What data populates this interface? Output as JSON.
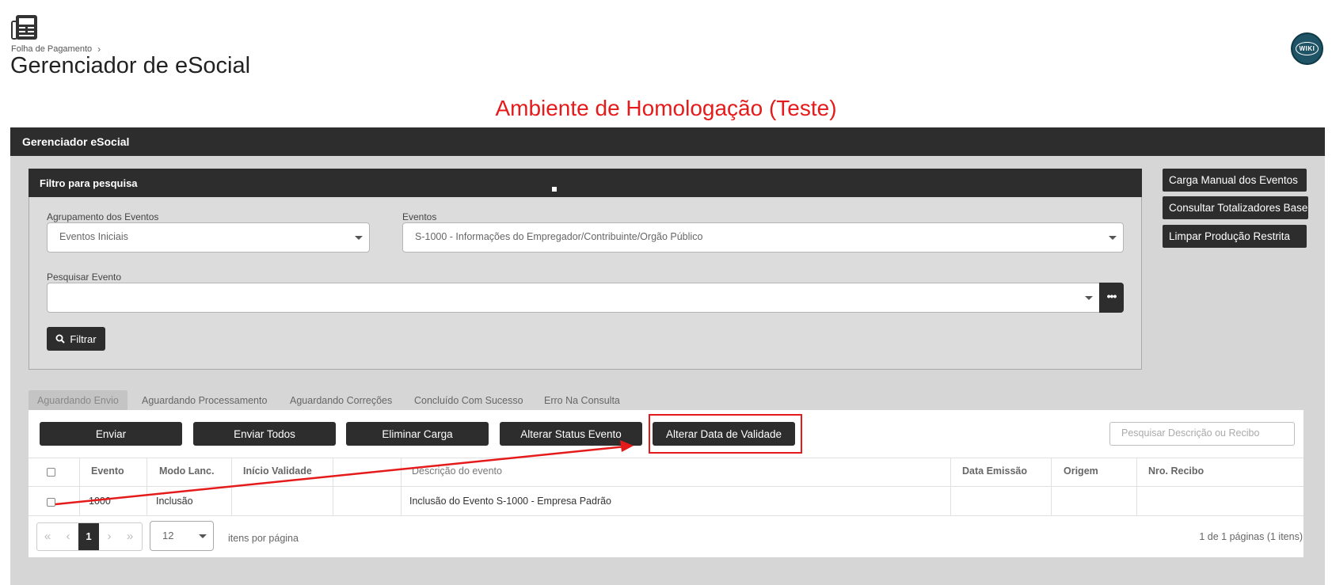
{
  "header": {
    "breadcrumb": "Folha de Pagamento",
    "title": "Gerenciador de eSocial",
    "wiki_label": "WIKI",
    "environment_banner": "Ambiente de Homologação (Teste)"
  },
  "main_panel": {
    "title": "Gerenciador eSocial"
  },
  "filter": {
    "title": "Filtro para pesquisa",
    "group_label": "Agrupamento dos Eventos",
    "group_value": "Eventos Iniciais",
    "events_label": "Eventos",
    "events_value": "S-1000 - Informações do Empregador/Contribuinte/Orgão Público",
    "search_label": "Pesquisar Evento",
    "search_value": "",
    "more_label": "•••",
    "filter_button": "Filtrar"
  },
  "side_buttons": {
    "manual_load": "Carga Manual dos Eventos",
    "totalizers": "Consultar Totalizadores Base",
    "clear_restricted": "Limpar Produção Restrita"
  },
  "tabs": [
    {
      "label": "Aguardando Envio"
    },
    {
      "label": "Aguardando Processamento"
    },
    {
      "label": "Aguardando Correções"
    },
    {
      "label": "Concluído Com Sucesso"
    },
    {
      "label": "Erro Na Consulta"
    }
  ],
  "actions": {
    "send": "Enviar",
    "send_all": "Enviar Todos",
    "delete_load": "Eliminar Carga",
    "change_status": "Alterar Status Evento",
    "change_validity": "Alterar Data de Validade",
    "search_placeholder": "Pesquisar Descrição ou Recibo"
  },
  "table": {
    "columns": [
      "Evento",
      "Modo Lanc.",
      "Início Validade",
      "",
      "Descrição do evento",
      "Data Emissão",
      "Origem",
      "Nro. Recibo"
    ],
    "rows": [
      {
        "evento": "1000",
        "modo": "Inclusão",
        "inicio": "",
        "extra": "",
        "descricao": "Inclusão do Evento S-1000 - Empresa Padrão",
        "data_emissao": "",
        "origem": "",
        "recibo": ""
      }
    ]
  },
  "pager": {
    "first": "«",
    "prev": "‹",
    "current_page": "1",
    "next": "›",
    "last": "»",
    "per_page": "12",
    "per_page_label": "itens por página",
    "info": "1 de 1 páginas (1 itens)"
  },
  "colors": {
    "dark": "#2d2d2d",
    "panel": "#d6d6d6",
    "highlight": "#e51b1b",
    "wiki": "#1f5366"
  }
}
